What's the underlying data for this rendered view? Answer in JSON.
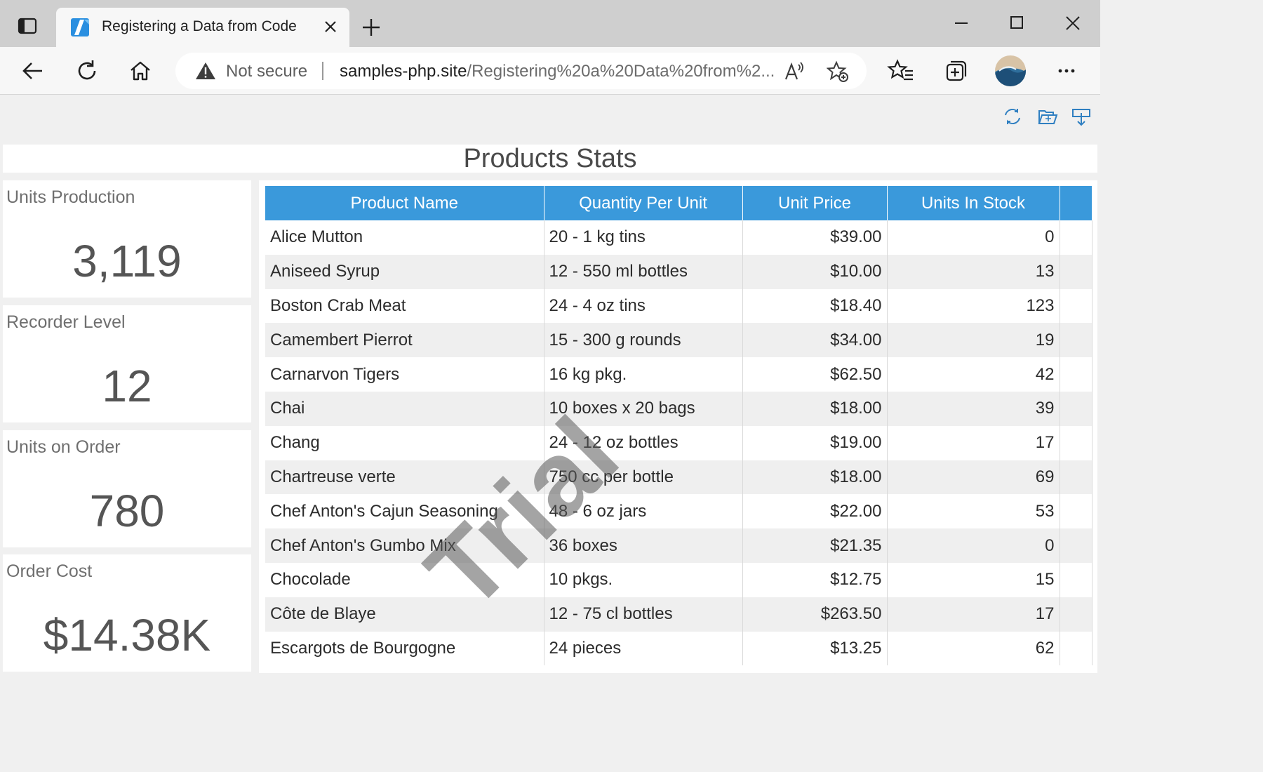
{
  "browser": {
    "tab_title": "Registering a Data from Code",
    "not_secure_label": "Not secure",
    "url_host": "samples-php.site",
    "url_path": "/Registering%20a%20Data%20from%2..."
  },
  "dashboard": {
    "title": "Products Stats",
    "kpis": [
      {
        "label": "Units Production",
        "value": "3,119"
      },
      {
        "label": "Recorder Level",
        "value": "12"
      },
      {
        "label": "Units on Order",
        "value": "780"
      },
      {
        "label": "Order Cost",
        "value": "$14.38K"
      }
    ],
    "watermark": "Trial",
    "grid": {
      "columns": [
        "Product Name",
        "Quantity Per Unit",
        "Unit Price",
        "Units In Stock"
      ],
      "rows": [
        [
          "Alice Mutton",
          "20 - 1 kg tins",
          "$39.00",
          "0"
        ],
        [
          "Aniseed Syrup",
          "12 - 550 ml bottles",
          "$10.00",
          "13"
        ],
        [
          "Boston Crab Meat",
          "24 - 4 oz tins",
          "$18.40",
          "123"
        ],
        [
          "Camembert Pierrot",
          "15 - 300 g rounds",
          "$34.00",
          "19"
        ],
        [
          "Carnarvon Tigers",
          "16 kg pkg.",
          "$62.50",
          "42"
        ],
        [
          "Chai",
          "10 boxes x 20 bags",
          "$18.00",
          "39"
        ],
        [
          "Chang",
          "24 - 12 oz bottles",
          "$19.00",
          "17"
        ],
        [
          "Chartreuse verte",
          "750 cc per bottle",
          "$18.00",
          "69"
        ],
        [
          "Chef Anton's Cajun Seasoning",
          "48 - 6 oz jars",
          "$22.00",
          "53"
        ],
        [
          "Chef Anton's Gumbo Mix",
          "36 boxes",
          "$21.35",
          "0"
        ],
        [
          "Chocolade",
          "10 pkgs.",
          "$12.75",
          "15"
        ],
        [
          "Côte de Blaye",
          "12 - 75 cl bottles",
          "$263.50",
          "17"
        ],
        [
          "Escargots de Bourgogne",
          "24 pieces",
          "$13.25",
          "62"
        ]
      ]
    }
  },
  "colors": {
    "header_blue": "#3a99db",
    "accent_blue": "#2f7fc1"
  }
}
